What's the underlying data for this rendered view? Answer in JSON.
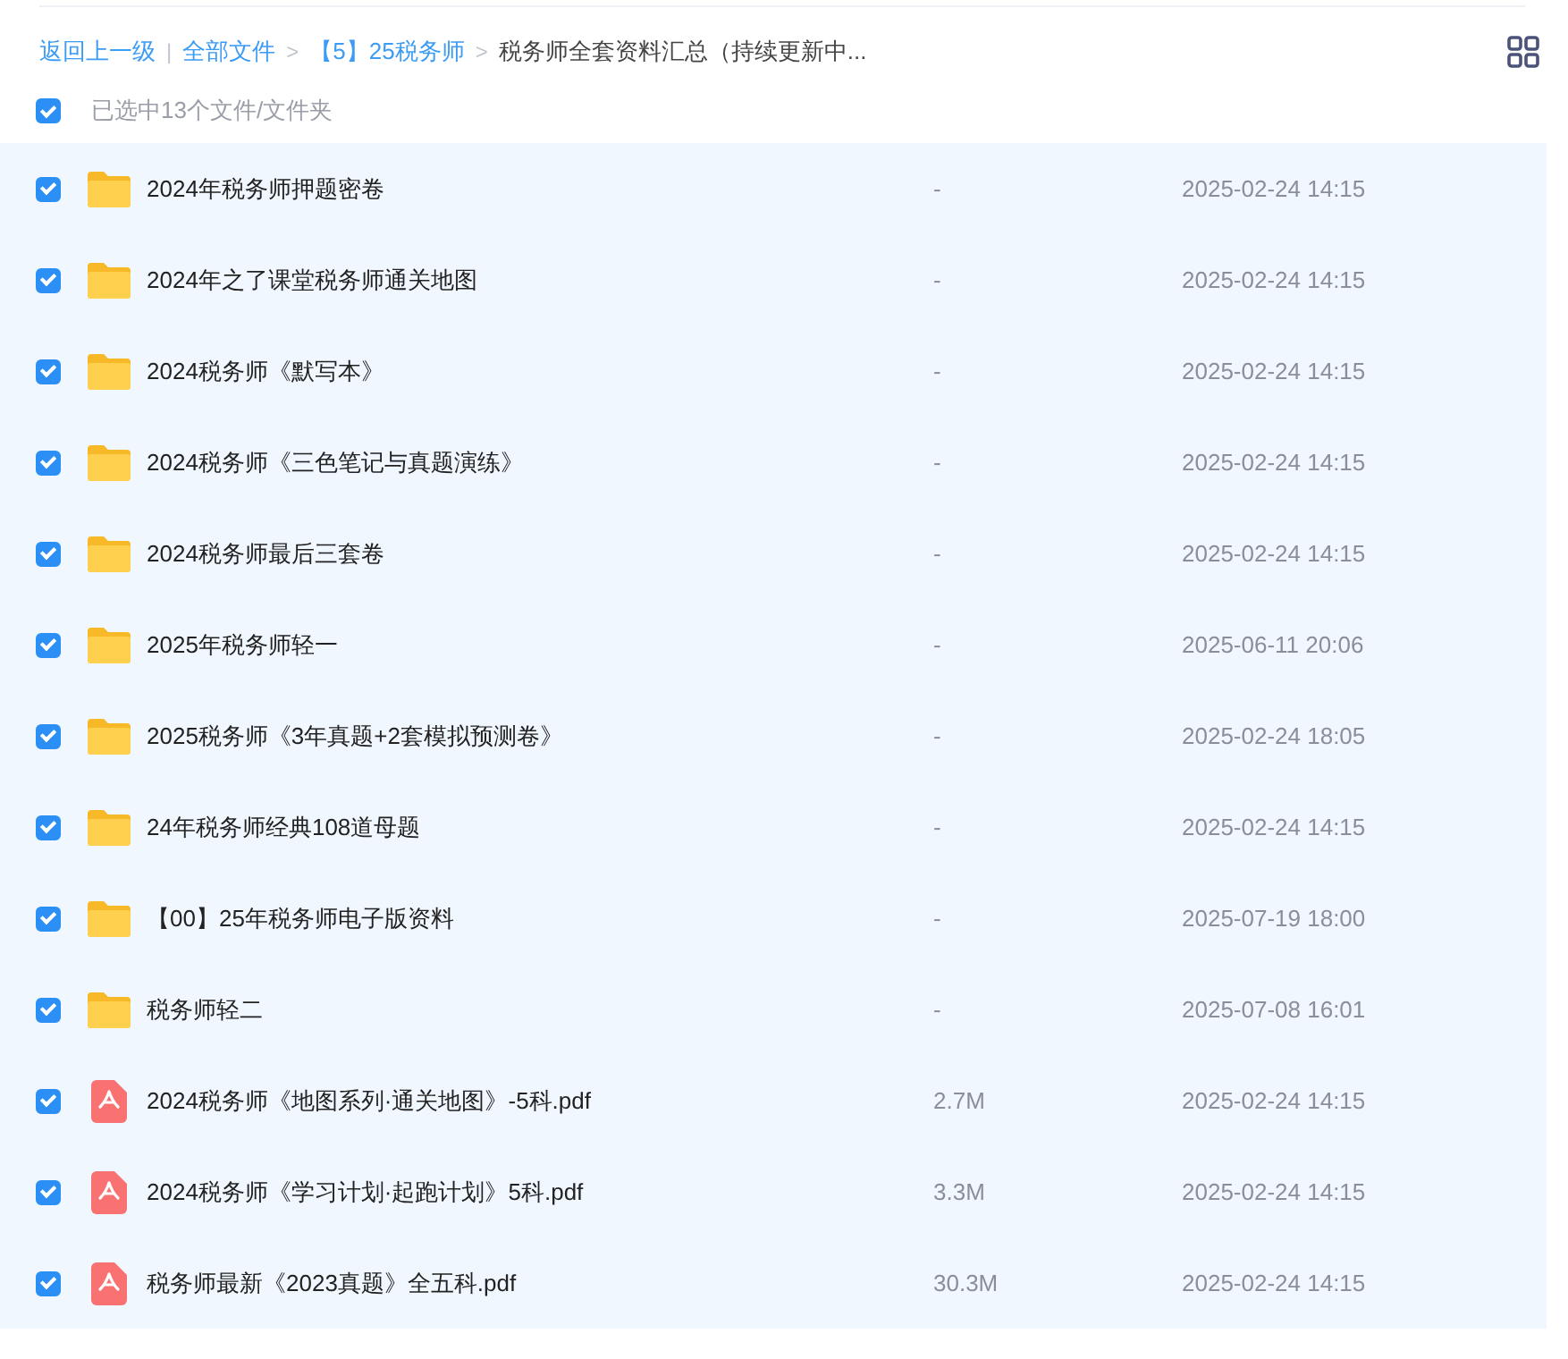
{
  "breadcrumb": [
    {
      "kind": "link",
      "text": "返回上一级"
    },
    {
      "kind": "sep",
      "text": "|"
    },
    {
      "kind": "link",
      "text": "全部文件"
    },
    {
      "kind": "sep",
      "text": ">"
    },
    {
      "kind": "link",
      "text": "【5】25税务师"
    },
    {
      "kind": "sep",
      "text": ">"
    },
    {
      "kind": "current",
      "text": "税务师全套资料汇总（持续更新中..."
    }
  ],
  "select_all": {
    "checked": true,
    "label": "已选中13个文件/文件夹"
  },
  "files": [
    {
      "kind": "folder",
      "name": "2024年税务师押题密卷",
      "size": "-",
      "date": "2025-02-24 14:15",
      "checked": true
    },
    {
      "kind": "folder",
      "name": "2024年之了课堂税务师通关地图",
      "size": "-",
      "date": "2025-02-24 14:15",
      "checked": true
    },
    {
      "kind": "folder",
      "name": "2024税务师《默写本》",
      "size": "-",
      "date": "2025-02-24 14:15",
      "checked": true
    },
    {
      "kind": "folder",
      "name": "2024税务师《三色笔记与真题演练》",
      "size": "-",
      "date": "2025-02-24 14:15",
      "checked": true
    },
    {
      "kind": "folder",
      "name": "2024税务师最后三套卷",
      "size": "-",
      "date": "2025-02-24 14:15",
      "checked": true
    },
    {
      "kind": "folder",
      "name": "2025年税务师轻一",
      "size": "-",
      "date": "2025-06-11 20:06",
      "checked": true
    },
    {
      "kind": "folder",
      "name": "2025税务师《3年真题+2套模拟预测卷》",
      "size": "-",
      "date": "2025-02-24 18:05",
      "checked": true
    },
    {
      "kind": "folder",
      "name": "24年税务师经典108道母题",
      "size": "-",
      "date": "2025-02-24 14:15",
      "checked": true
    },
    {
      "kind": "folder",
      "name": "【00】25年税务师电子版资料",
      "size": "-",
      "date": "2025-07-19 18:00",
      "checked": true
    },
    {
      "kind": "folder",
      "name": "税务师轻二",
      "size": "-",
      "date": "2025-07-08 16:01",
      "checked": true
    },
    {
      "kind": "pdf",
      "name": "2024税务师《地图系列·通关地图》-5科.pdf",
      "size": "2.7M",
      "date": "2025-02-24 14:15",
      "checked": true
    },
    {
      "kind": "pdf",
      "name": "2024税务师《学习计划·起跑计划》5科.pdf",
      "size": "3.3M",
      "date": "2025-02-24 14:15",
      "checked": true
    },
    {
      "kind": "pdf",
      "name": "税务师最新《2023真题》全五科.pdf",
      "size": "30.3M",
      "date": "2025-02-24 14:15",
      "checked": true
    }
  ]
}
